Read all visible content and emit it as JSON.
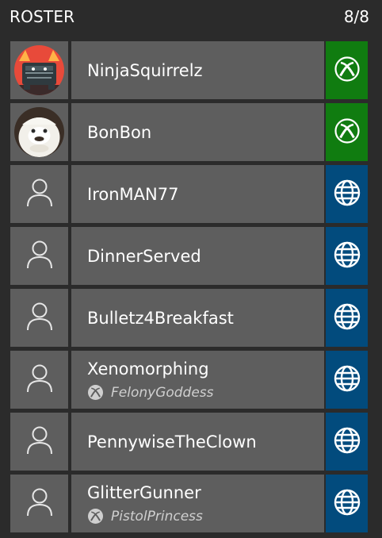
{
  "header": {
    "title": "ROSTER",
    "count": "8/8"
  },
  "colors": {
    "background": "#2b2b2b",
    "cell": "#5e5e5e",
    "xbox_green": "#107c10",
    "web_blue": "#024b7d"
  },
  "players": [
    {
      "gamertag": "NinjaSquirrelz",
      "sub": "",
      "platform": "xbox",
      "avatar": "ninja-avatar"
    },
    {
      "gamertag": "BonBon",
      "sub": "",
      "platform": "xbox",
      "avatar": "bonbon-avatar"
    },
    {
      "gamertag": "IronMAN77",
      "sub": "",
      "platform": "web",
      "avatar": "generic-person"
    },
    {
      "gamertag": "DinnerServed",
      "sub": "",
      "platform": "web",
      "avatar": "generic-person"
    },
    {
      "gamertag": "Bulletz4Breakfast",
      "sub": "",
      "platform": "web",
      "avatar": "generic-person"
    },
    {
      "gamertag": "Xenomorphing",
      "sub": "FelonyGoddess",
      "platform": "web",
      "avatar": "generic-person"
    },
    {
      "gamertag": "PennywiseTheClown",
      "sub": "",
      "platform": "web",
      "avatar": "generic-person"
    },
    {
      "gamertag": "GlitterGunner",
      "sub": "PistolPrincess",
      "platform": "web",
      "avatar": "generic-person"
    }
  ]
}
